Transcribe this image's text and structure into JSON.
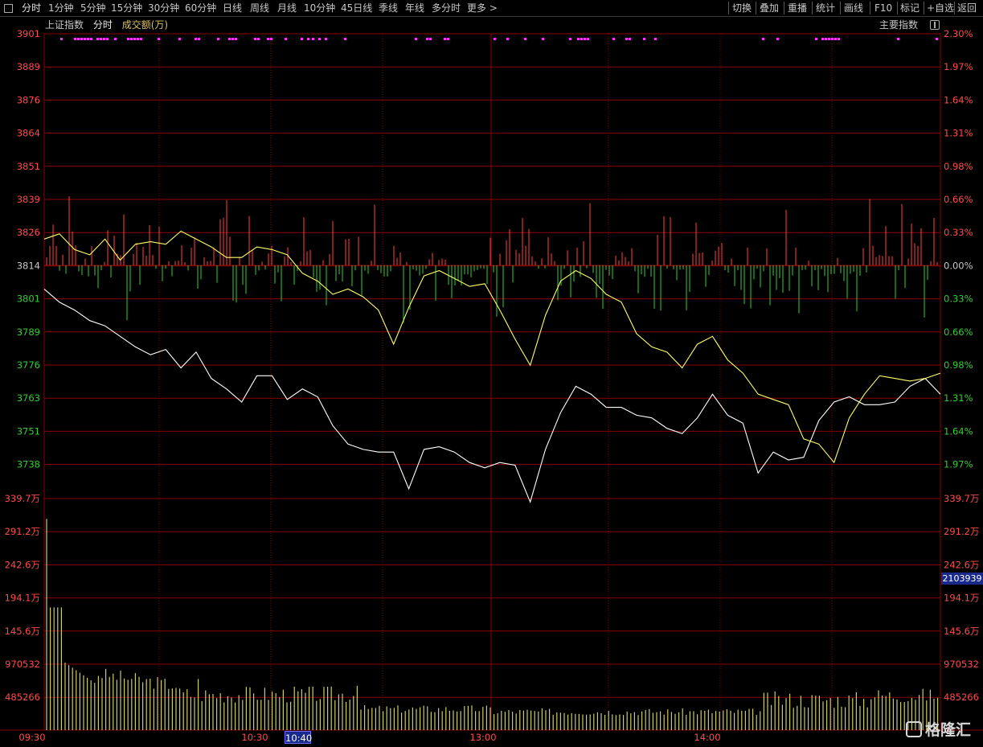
{
  "toolbar": {
    "periods": [
      "分时",
      "1分钟",
      "5分钟",
      "15分钟",
      "30分钟",
      "60分钟",
      "日线",
      "周线",
      "月线",
      "10分钟",
      "45日线",
      "季线",
      "年线",
      "多分时",
      "更多 >"
    ],
    "actions": [
      "切换",
      "叠加",
      "重播",
      "统计",
      "画线",
      "F10",
      "标记",
      "+自选",
      "返回"
    ]
  },
  "header": {
    "index_name": "上证指数",
    "mode": "分时",
    "indicator": "成交额(万)",
    "main_index_button": "主要指数"
  },
  "axes": {
    "price_ticks": [
      "3901",
      "3889",
      "3876",
      "3864",
      "3851",
      "3839",
      "3826",
      "3814",
      "3801",
      "3789",
      "3776",
      "3763",
      "3751",
      "3738"
    ],
    "pct_ticks": [
      "2.30%",
      "1.97%",
      "1.64%",
      "1.31%",
      "0.98%",
      "0.66%",
      "0.33%",
      "0.00%",
      "0.33%",
      "0.66%",
      "0.98%",
      "1.31%",
      "1.64%",
      "1.97%"
    ],
    "vol_ticks": [
      "339.7万",
      "291.2万",
      "242.6万",
      "194.1万",
      "145.6万",
      "970532",
      "485266"
    ],
    "time_ticks": [
      "09:30",
      "10:30",
      "13:00",
      "14:00"
    ],
    "cursor_time": "10:40",
    "cursor_volume": "2103939"
  },
  "colors": {
    "grid": "#8b0000",
    "price_up": "#ff4040",
    "price_down": "#33cc33",
    "white_line": "#ffffff",
    "yellow_line": "#ffff66",
    "volume_bars": "#cccc66",
    "signal_dots": "#ff33ff",
    "axis_label_price": "#ff4a4a",
    "axis_label_vol": "#ff4a4a"
  },
  "watermark": "格隆汇",
  "chart_data": {
    "type": "line",
    "time_range": [
      "09:30",
      "15:00"
    ],
    "price_range": [
      3738,
      3901
    ],
    "prev_close": 3814,
    "series": [
      {
        "values": [
          3805,
          3800,
          3797,
          3793,
          3791,
          3787,
          3783,
          3780,
          3782,
          3775,
          3781,
          3771,
          3767,
          3762,
          3772,
          3772,
          3763,
          3767,
          3764,
          3753,
          3746,
          3744,
          3743,
          3743,
          3729,
          3744,
          3745,
          3743,
          3739,
          3737,
          3739,
          3738,
          3724,
          3744,
          3758,
          3768,
          3765,
          3760,
          3760,
          3757,
          3756,
          3752,
          3750,
          3756,
          3765,
          3757,
          3754,
          3735,
          3743,
          3740,
          3741,
          3755,
          3762,
          3764,
          3761,
          3761,
          3762,
          3768,
          3771,
          3765
        ]
      },
      {
        "values": [
          3824,
          3826,
          3820,
          3818,
          3824,
          3816,
          3822,
          3823,
          3822,
          3827,
          3824,
          3821,
          3817,
          3817,
          3821,
          3820,
          3818,
          3811,
          3808,
          3803,
          3805,
          3802,
          3797,
          3784,
          3798,
          3810,
          3812,
          3809,
          3806,
          3807,
          3797,
          3786,
          3776,
          3795,
          3808,
          3812,
          3809,
          3803,
          3800,
          3788,
          3783,
          3781,
          3775,
          3784,
          3787,
          3778,
          3773,
          3765,
          3763,
          3761,
          3748,
          3746,
          3739,
          3756,
          3765,
          3772,
          3771,
          3770,
          3771,
          3773
        ]
      }
    ]
  }
}
